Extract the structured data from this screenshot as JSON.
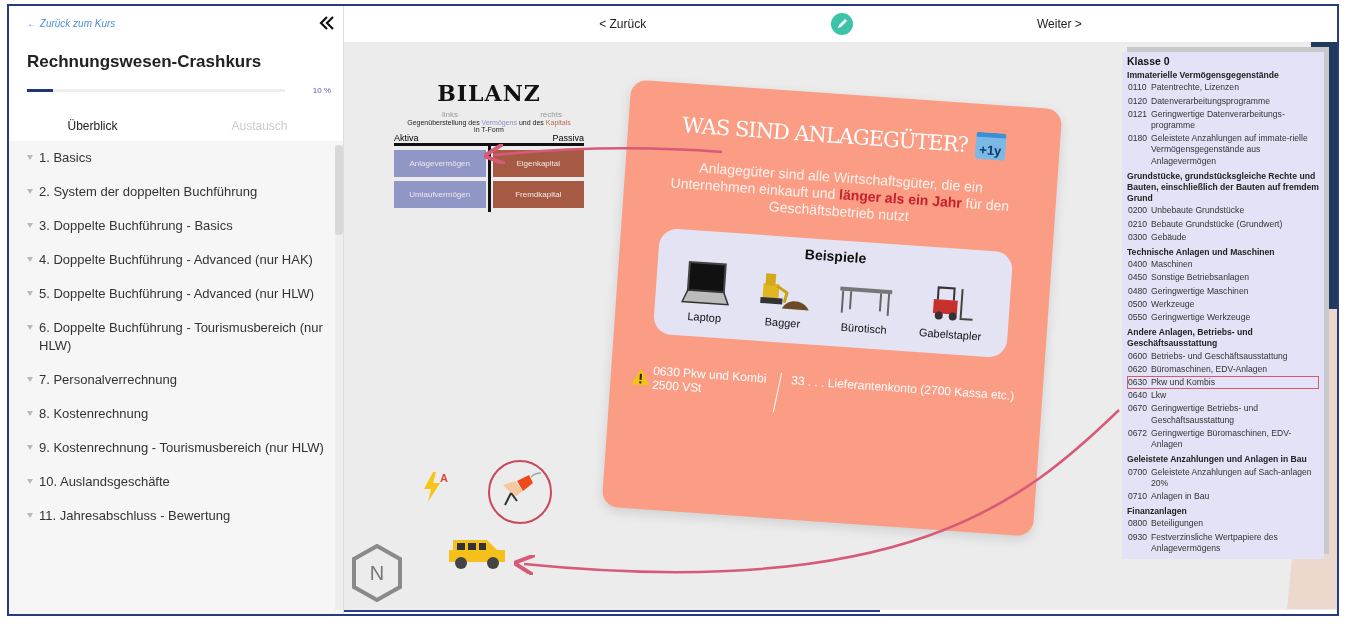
{
  "sidebar": {
    "back_link": "← Zurück zum Kurs",
    "course_title": "Rechnungswesen-Crashkurs",
    "progress": {
      "level": 0.1,
      "reading": "10 %"
    },
    "tabs": [
      {
        "label": "Überblick",
        "selected": true
      },
      {
        "label": "Austausch",
        "selected": false
      }
    ],
    "chapters": [
      "1. Basics",
      "2. System der doppelten Buchführung",
      "3. Doppelte Buchführung - Basics",
      "4. Doppelte Buchführung - Advanced (nur HAK)",
      "5. Doppelte Buchführung - Advanced (nur HLW)",
      "6. Doppelte Buchführung - Tourismusbereich (nur HLW)",
      "7. Personalverrechnung",
      "8. Kostenrechnung",
      "9. Kostenrechnung - Tourismusbereich (nur HLW)",
      "10. Auslandsgeschäfte",
      "11. Jahresabschluss - Bewertung"
    ]
  },
  "topbar": {
    "back": "< Zurück",
    "next": "Weiter >"
  },
  "slide": {
    "bilanz": {
      "title": "BILANZ",
      "note_left": "links",
      "note_right": "rechts",
      "subtitle": [
        {
          "text": "Gegenüberstellung des ",
          "kind": "plain"
        },
        {
          "text": "Vermögens",
          "kind": "asset"
        },
        {
          "text": " und des ",
          "kind": "plain"
        },
        {
          "text": "Kapitals",
          "kind": "capital"
        },
        {
          "text": " in T-Form",
          "kind": "plain"
        }
      ],
      "left_label": "Aktiva",
      "right_label": "Passiva",
      "aktiva": [
        "Anlagevermögen",
        "Umlaufvermögen"
      ],
      "passiva": [
        "Eigenkapital",
        "Fremdkapital"
      ]
    },
    "card": {
      "title": "WAS SIND ANLAGEGÜTER?",
      "badge": "+1y",
      "text": "Anlagegüter sind alle Wirtschaftsgüter, die ein Unternehmen einkauft und **länger als ein Jahr** für den Geschäftsbetrieb nutzt",
      "examples_title": "Beispiele",
      "examples": [
        {
          "label": "Laptop",
          "kind": "laptop"
        },
        {
          "label": "Bagger",
          "kind": "excavator"
        },
        {
          "label": "Bürotisch",
          "kind": "table"
        },
        {
          "label": "Gabelstapler",
          "kind": "forklift"
        }
      ],
      "debit": [
        "0630 Pkw und Kombi",
        "2500 VSt"
      ],
      "credit": "33 . . . Lieferantenkonto (2700 Kassa etc.)"
    },
    "lightning_letter": "A",
    "hexagon_letter": "N",
    "accounts": {
      "title": "Klasse 0",
      "groups": [
        {
          "heading": "Immaterielle Vermögensgegenstände",
          "items": [
            {
              "code": "0110",
              "name": "Patentrechte, Lizenzen",
              "highlighted": false
            },
            {
              "code": "0120",
              "name": "Datenverarbeitungsprogramme",
              "highlighted": false
            },
            {
              "code": "0121",
              "name": "Geringwertige Datenverarbeitungs-programme",
              "highlighted": false
            },
            {
              "code": "0180",
              "name": "Geleistete Anzahlungen auf immate-rielle Vermögensgegenstände aus Anlagevermögen",
              "highlighted": false
            }
          ]
        },
        {
          "heading": "Grundstücke, grundstücksgleiche Rechte und Bauten, einschließlich der Bauten auf fremdem Grund",
          "items": [
            {
              "code": "0200",
              "name": "Unbebaute Grundstücke",
              "highlighted": false
            },
            {
              "code": "0210",
              "name": "Bebaute Grundstücke (Grundwert)",
              "highlighted": false
            },
            {
              "code": "0300",
              "name": "Gebäude",
              "highlighted": false
            }
          ]
        },
        {
          "heading": "Technische Anlagen und Maschinen",
          "items": [
            {
              "code": "0400",
              "name": "Maschinen",
              "highlighted": false
            },
            {
              "code": "0450",
              "name": "Sonstige Betriebsanlagen",
              "highlighted": false
            },
            {
              "code": "0480",
              "name": "Geringwertige Maschinen",
              "highlighted": false
            },
            {
              "code": "0500",
              "name": "Werkzeuge",
              "highlighted": false
            },
            {
              "code": "0550",
              "name": "Geringwertige Werkzeuge",
              "highlighted": false
            }
          ]
        },
        {
          "heading": "Andere Anlagen, Betriebs- und Geschäftsausstattung",
          "items": [
            {
              "code": "0600",
              "name": "Betriebs- und Geschäftsausstattung",
              "highlighted": false
            },
            {
              "code": "0620",
              "name": "Büromaschinen, EDV-Anlagen",
              "highlighted": false
            },
            {
              "code": "0630",
              "name": "Pkw und Kombis",
              "highlighted": true
            },
            {
              "code": "0640",
              "name": "Lkw",
              "highlighted": false
            },
            {
              "code": "0670",
              "name": "Geringwertige Betriebs- und Geschäftsausstattung",
              "highlighted": false
            },
            {
              "code": "0672",
              "name": "Geringwertige Büromaschinen, EDV-Anlagen",
              "highlighted": false
            }
          ]
        },
        {
          "heading": "Geleistete Anzahlungen und Anlagen in Bau",
          "items": [
            {
              "code": "0700",
              "name": "Geleistete Anzahlungen auf Sach-anlagen 20%",
              "highlighted": false
            },
            {
              "code": "0710",
              "name": "Anlagen in Bau",
              "highlighted": false
            }
          ]
        },
        {
          "heading": "Finanzanlagen",
          "items": [
            {
              "code": "0800",
              "name": "Beteiligungen",
              "highlighted": false
            },
            {
              "code": "0930",
              "name": "Festverzinsliche Wertpapiere des Anlagevermögens",
              "highlighted": false
            }
          ]
        }
      ]
    }
  },
  "slide_progress": {
    "level": 0.54
  }
}
